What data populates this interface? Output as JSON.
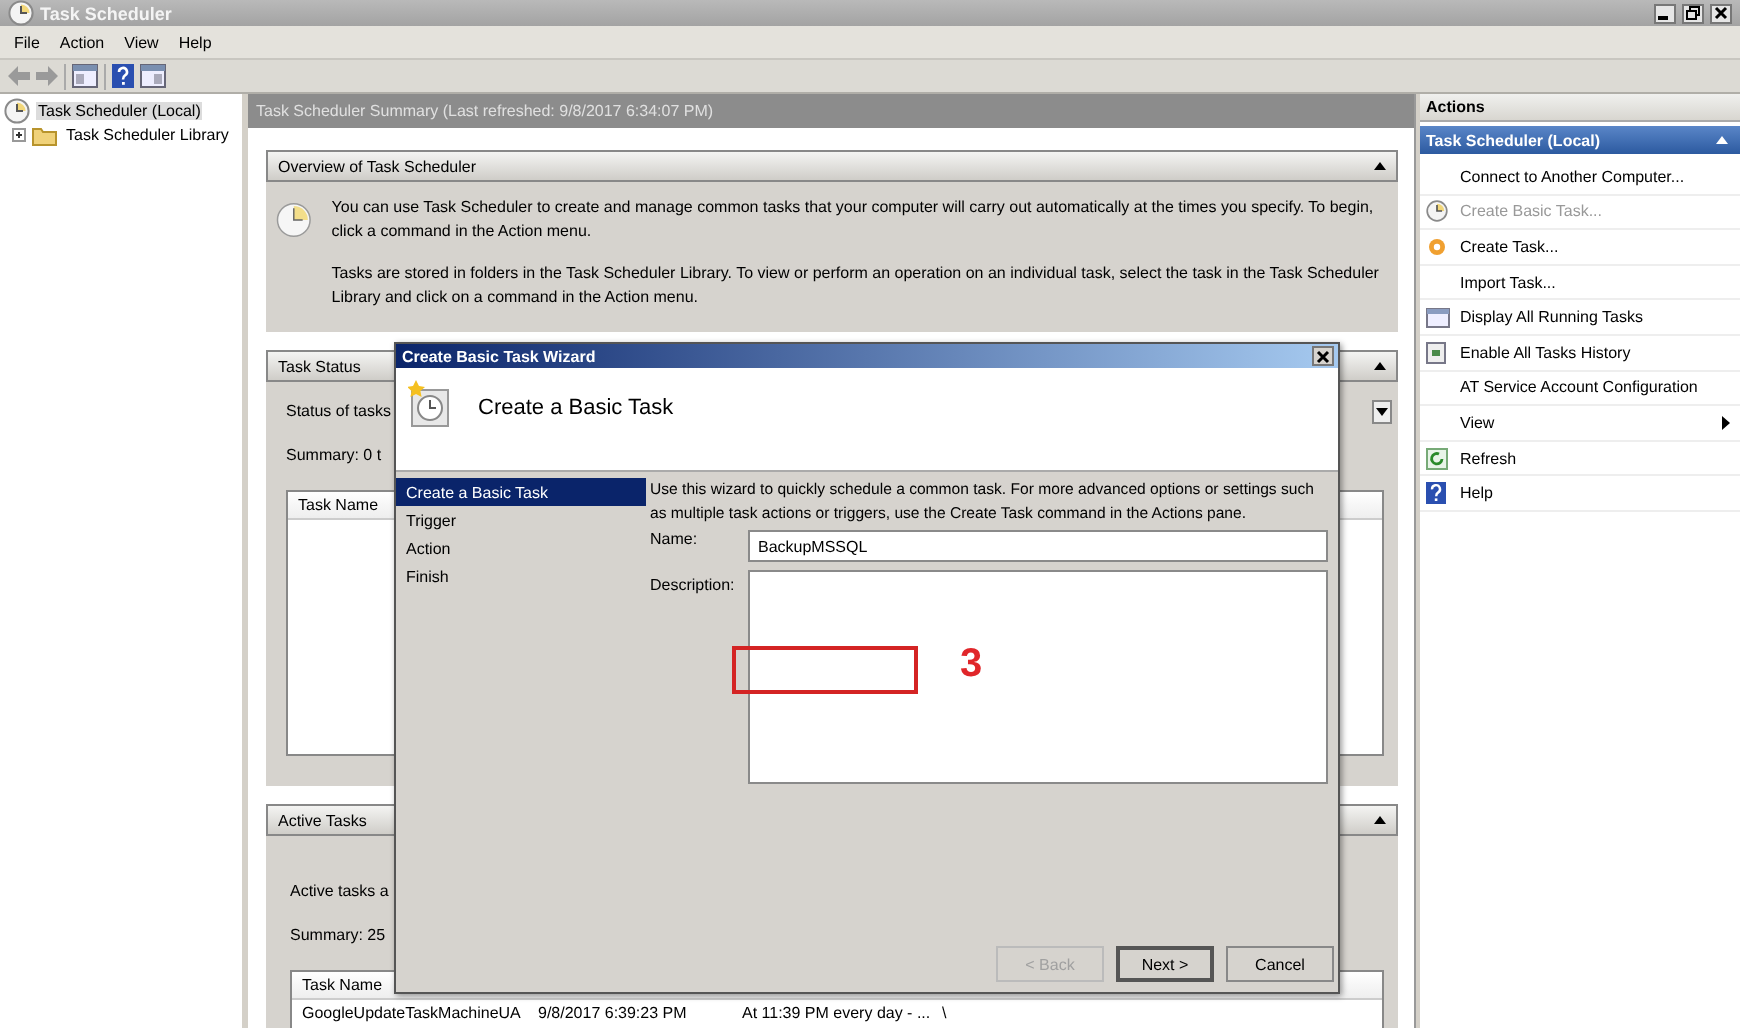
{
  "window": {
    "title": "Task Scheduler"
  },
  "menu": [
    {
      "label": "File"
    },
    {
      "label": "Action"
    },
    {
      "label": "View"
    },
    {
      "label": "Help"
    }
  ],
  "tree": [
    {
      "label": "Task Scheduler (Local)",
      "selected": true,
      "children": [
        {
          "label": "Task Scheduler Library",
          "expanded": false
        }
      ]
    }
  ],
  "summary": {
    "title": "Task Scheduler Summary (Last refreshed: 9/8/2017 6:34:07 PM)",
    "sections": [
      {
        "kind": "overview",
        "title": "Overview of Task Scheduler",
        "expanded": true,
        "paragraphs": [
          "You can use Task Scheduler to create and manage common tasks that your computer will carry out automatically at the times you specify. To begin, click a command in the Action menu.",
          "Tasks are stored in folders in the Task Scheduler Library. To view or perform an operation on an individual task, select the task in the Task Scheduler Library and click on a command in the Action menu."
        ]
      },
      {
        "kind": "status",
        "title": "Task Status",
        "expanded": true,
        "lines": [
          "Status of tasks",
          "Summary: 0 t"
        ],
        "table": {
          "columns": [
            "Task Name"
          ]
        }
      },
      {
        "kind": "active",
        "title": "Active Tasks",
        "expanded": true,
        "lines": [
          "Active tasks a",
          "Summary: 25"
        ],
        "table": {
          "columns": [
            "Task Name"
          ],
          "rows": [
            [
              "GoogleUpdateTaskMachineUA",
              "9/8/2017 6:39:23 PM",
              "At 11:39 PM every day - ...",
              "\\"
            ]
          ]
        }
      }
    ]
  },
  "actions": {
    "title": "Actions",
    "group": {
      "label": "Task Scheduler (Local)",
      "expanded": true
    },
    "items": [
      {
        "label": "Connect to Another Computer...",
        "disabled": false
      },
      {
        "label": "Create Basic Task...",
        "disabled": true
      },
      {
        "label": "Create Task...",
        "disabled": false
      },
      {
        "label": "Import Task...",
        "disabled": false
      },
      {
        "label": "Display All Running Tasks",
        "disabled": false
      },
      {
        "label": "Enable All Tasks History",
        "disabled": false
      },
      {
        "label": "AT Service Account Configuration",
        "disabled": false
      },
      {
        "label": "View",
        "disabled": false,
        "submenu": true
      },
      {
        "label": "Refresh",
        "disabled": false
      },
      {
        "label": "Help",
        "disabled": false
      }
    ]
  },
  "wizard": {
    "title": "Create Basic Task Wizard",
    "heading": "Create a Basic Task",
    "steps": [
      {
        "label": "Create a Basic Task",
        "selected": true
      },
      {
        "label": "Trigger",
        "selected": false
      },
      {
        "label": "Action",
        "selected": false
      },
      {
        "label": "Finish",
        "selected": false
      }
    ],
    "intro": "Use this wizard to quickly schedule a common task.  For more advanced options or settings such as multiple task actions or triggers, use the Create Task command in the Actions pane.",
    "name_label": "Name:",
    "name_value": "BackupMSSQL",
    "description_label": "Description:",
    "buttons": [
      {
        "label": "< Back",
        "disabled": true
      },
      {
        "label": "Next >",
        "disabled": false
      },
      {
        "label": "Cancel",
        "disabled": false
      }
    ],
    "annotation": {
      "label": "3"
    }
  }
}
